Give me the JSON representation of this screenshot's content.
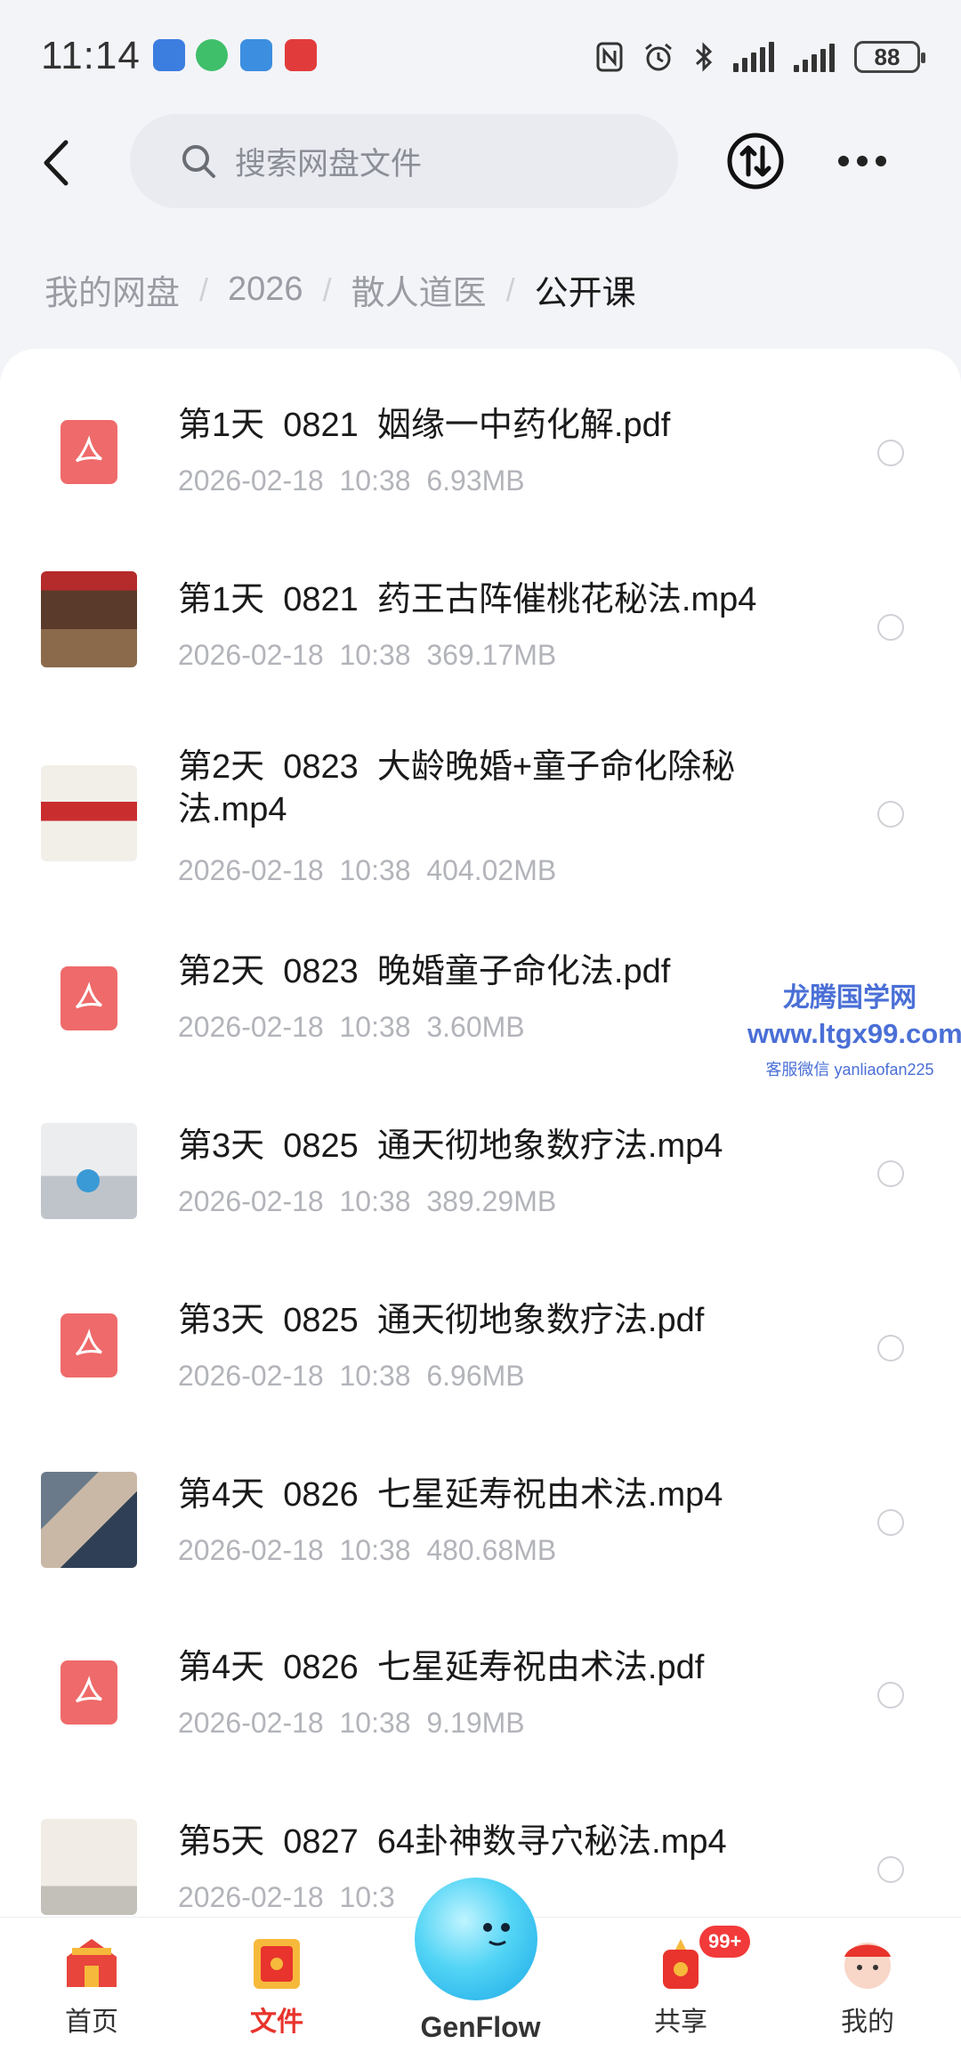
{
  "status_bar": {
    "time": "11:14",
    "battery": "88"
  },
  "header": {
    "search_placeholder": "搜索网盘文件"
  },
  "breadcrumb": {
    "items": [
      "我的网盘",
      "2026",
      "散人道医"
    ],
    "current": "公开课",
    "separator": "/"
  },
  "files": [
    {
      "name": "第1天  0821  姻缘一中药化解.pdf",
      "meta": "2026-02-18  10:38  6.93MB",
      "type": "pdf"
    },
    {
      "name": "第1天  0821  药王古阵催桃花秘法.mp4",
      "meta": "2026-02-18  10:38  369.17MB",
      "type": "video"
    },
    {
      "name": "第2天  0823  大龄晚婚+童子命化除秘\n法.mp4",
      "meta": "2026-02-18  10:38  404.02MB",
      "type": "video"
    },
    {
      "name": "第2天  0823  晚婚童子命化法.pdf",
      "meta": "2026-02-18  10:38  3.60MB",
      "type": "pdf"
    },
    {
      "name": "第3天  0825  通天彻地象数疗法.mp4",
      "meta": "2026-02-18  10:38  389.29MB",
      "type": "video"
    },
    {
      "name": "第3天  0825  通天彻地象数疗法.pdf",
      "meta": "2026-02-18  10:38  6.96MB",
      "type": "pdf"
    },
    {
      "name": "第4天  0826  七星延寿祝由术法.mp4",
      "meta": "2026-02-18  10:38  480.68MB",
      "type": "video"
    },
    {
      "name": "第4天  0826  七星延寿祝由术法.pdf",
      "meta": "2026-02-18  10:38  9.19MB",
      "type": "pdf"
    },
    {
      "name": "第5天  0827  64卦神数寻穴秘法.mp4",
      "meta": "2026-02-18  10:3",
      "type": "video"
    }
  ],
  "watermark": {
    "line1": "龙腾国学网",
    "line2": "www.ltgx99.com",
    "line3": "客服微信 yanliaofan225"
  },
  "tabbar": {
    "home": "首页",
    "files": "文件",
    "genflow": "GenFlow",
    "share": "共享",
    "mine": "我的",
    "share_badge": "99+"
  },
  "colors": {
    "accent": "#e8342c",
    "pdf": "#ef6a6a",
    "watermark": "#4a6fd6"
  }
}
